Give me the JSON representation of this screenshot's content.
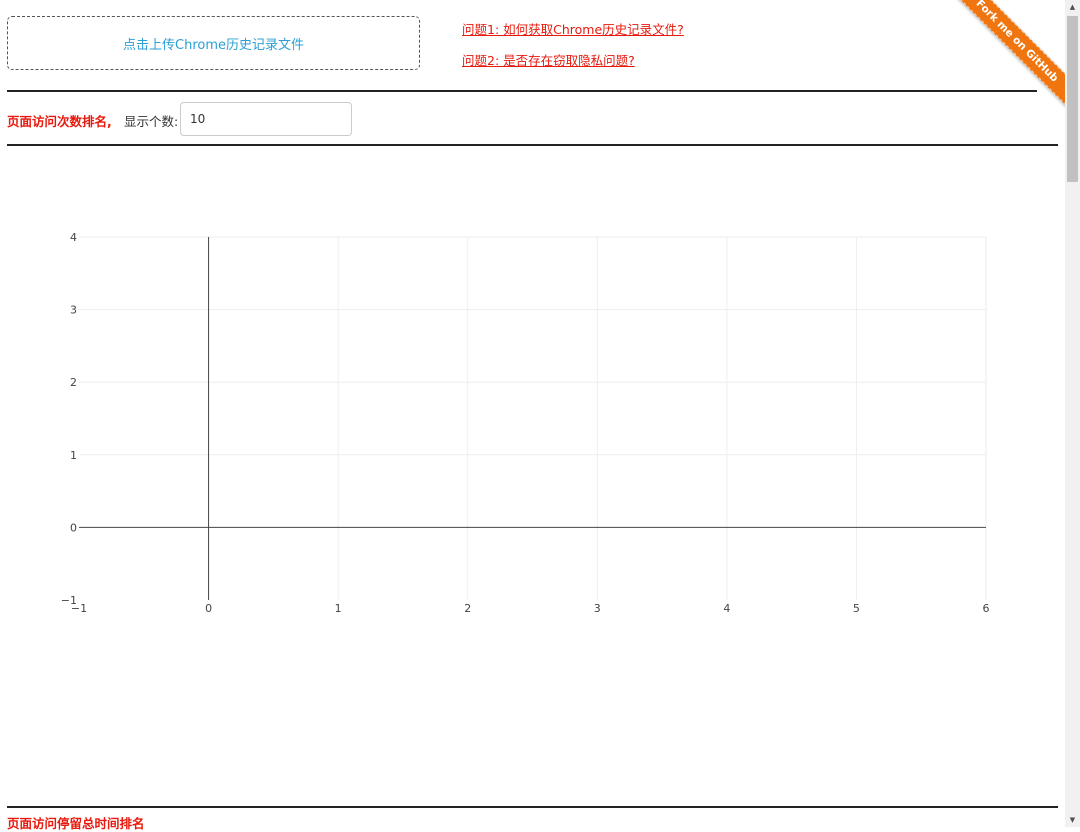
{
  "upload": {
    "label": "点击上传Chrome历史记录文件"
  },
  "faq": {
    "q1": "问题1: 如何获取Chrome历史记录文件?",
    "q2": "问题2: 是否存在窃取隐私问题?"
  },
  "ribbon": {
    "label": "Fork me on GitHub",
    "color": "#f0750f"
  },
  "section1": {
    "title": "页面访问次数排名,",
    "count_label": "显示个数:",
    "count_value": "10"
  },
  "section2": {
    "title": "页面访问停留总时间排名"
  },
  "chart_data": {
    "type": "scatter",
    "x": [],
    "y": [],
    "xlim": [
      -1,
      6
    ],
    "ylim": [
      -1,
      4
    ],
    "xticks": [
      "−1",
      "0",
      "1",
      "2",
      "3",
      "4",
      "5",
      "6"
    ],
    "yticks": [
      "−1",
      "0",
      "1",
      "2",
      "3",
      "4"
    ],
    "grid": true,
    "title": "",
    "xlabel": "",
    "ylabel": ""
  },
  "colors": {
    "link": "#e8190d",
    "accent": "#2a9fd6"
  },
  "icons": {
    "scroll_up": "triangle-up-icon",
    "scroll_down": "triangle-down-icon"
  }
}
